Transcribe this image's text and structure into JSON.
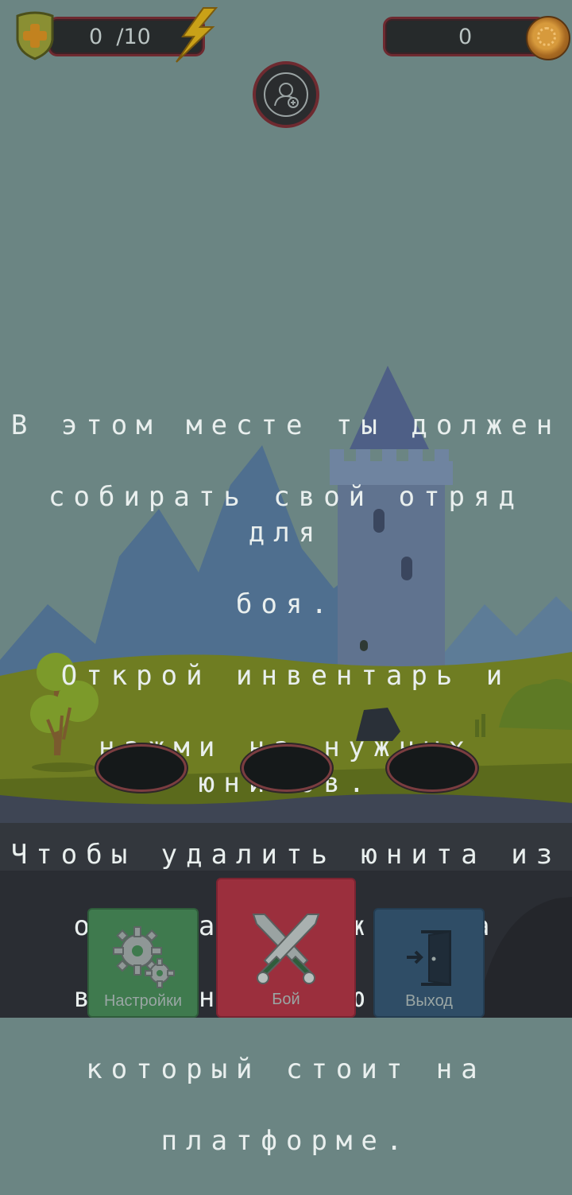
{
  "hud": {
    "energy_text": "0  /10",
    "coins_text": "0"
  },
  "tutorial": {
    "lines": [
      "В этом месте ты должен",
      "собирать свой отряд для",
      "боя.",
      "Открой инвентарь и",
      "нажми на нужных юнитов.",
      "Чтобы удалить юнита из",
      "отряда - нажми на",
      "выбранного юнита,",
      "который стоит на",
      "платформе."
    ]
  },
  "bottom_menu": {
    "settings_label": "Настройки",
    "battle_label": "Бой",
    "exit_label": "Выход"
  },
  "colors": {
    "sky": "#6b8583",
    "grass": "#6f7d22",
    "settings_button": "#3f7a4e",
    "battle_button": "#9b2f3d",
    "exit_button": "#2f4d66"
  },
  "icons": {
    "shield": "shield-plus-icon",
    "energy": "lightning-bolt-icon",
    "coin": "coin-icon",
    "squad": "add-user-icon",
    "settings": "gears-icon",
    "battle": "crossed-swords-icon",
    "exit": "exit-door-icon"
  }
}
